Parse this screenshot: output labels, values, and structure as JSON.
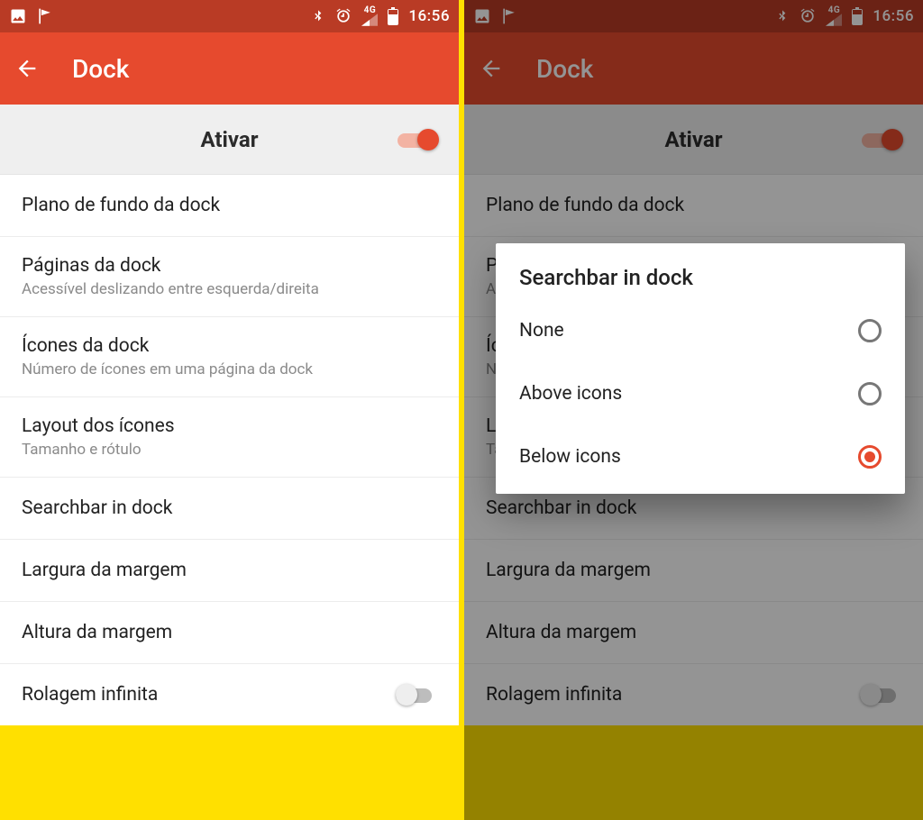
{
  "status": {
    "time": "16:56",
    "network_label": "4G"
  },
  "appbar": {
    "title": "Dock"
  },
  "enable": {
    "label": "Ativar",
    "on": true
  },
  "items": [
    {
      "title": "Plano de fundo da dock",
      "sub": ""
    },
    {
      "title": "Páginas da dock",
      "sub": "Acessível deslizando entre esquerda/direita"
    },
    {
      "title": "Ícones da dock",
      "sub": "Número de ícones em uma página da dock"
    },
    {
      "title": "Layout dos ícones",
      "sub": "Tamanho e rótulo"
    },
    {
      "title": "Searchbar in dock",
      "sub": ""
    },
    {
      "title": "Largura da margem",
      "sub": ""
    },
    {
      "title": "Altura da margem",
      "sub": ""
    },
    {
      "title": "Rolagem infinita",
      "sub": "",
      "switch": true,
      "switch_on": false
    }
  ],
  "dialog": {
    "title": "Searchbar in dock",
    "options": [
      {
        "label": "None",
        "selected": false
      },
      {
        "label": "Above icons",
        "selected": false
      },
      {
        "label": "Below icons",
        "selected": true
      }
    ]
  },
  "colors": {
    "primary": "#e64a2e",
    "primary_dark": "#b93b25"
  }
}
